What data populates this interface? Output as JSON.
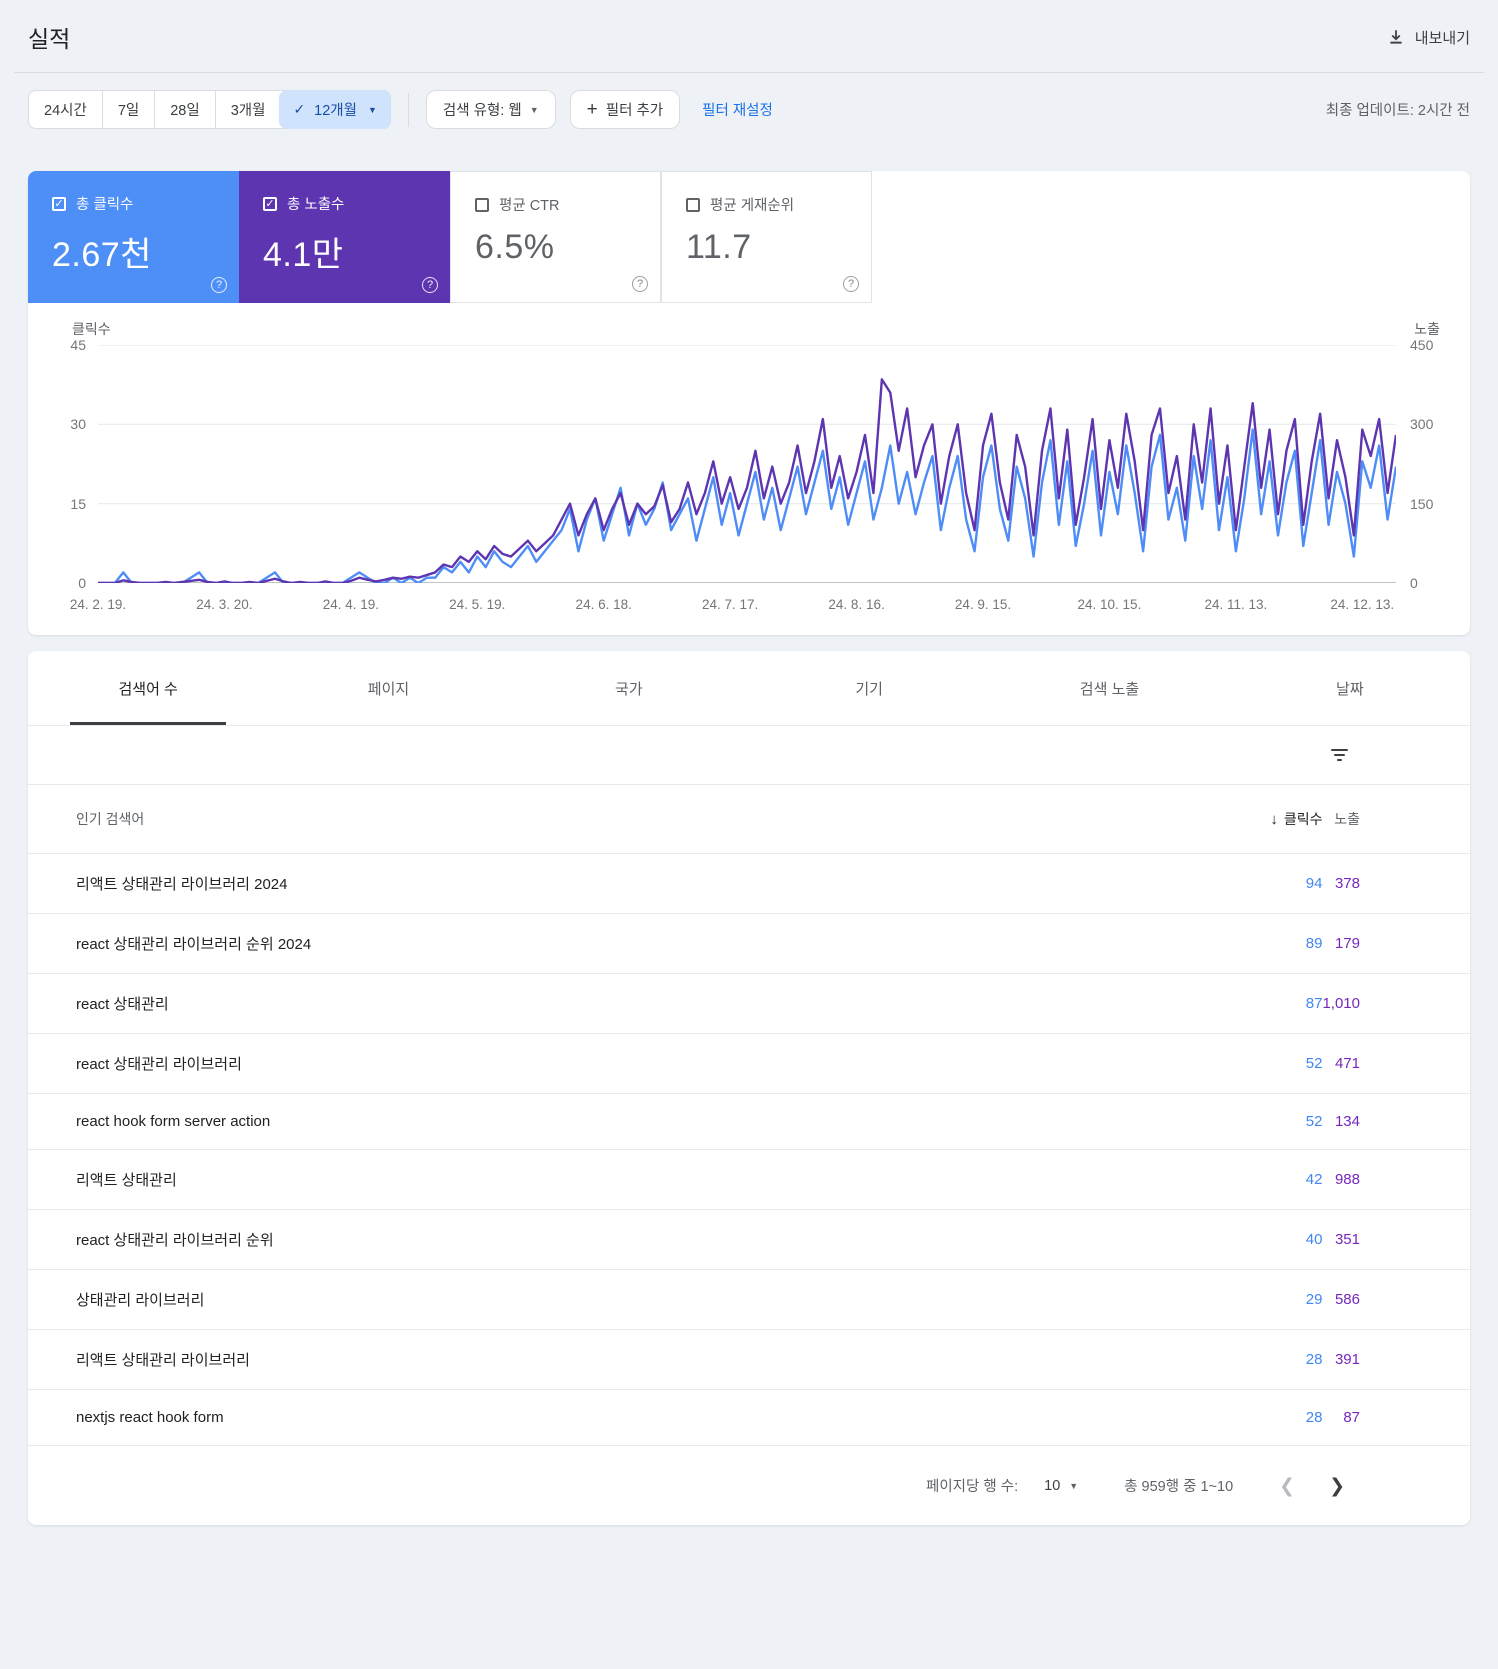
{
  "header": {
    "title": "실적",
    "export_label": "내보내기"
  },
  "toolbar": {
    "date_ranges": [
      "24시간",
      "7일",
      "28일",
      "3개월"
    ],
    "selected_range": "12개월",
    "search_type_label": "검색 유형: 웹",
    "add_filter_label": "필터 추가",
    "reset_filters_label": "필터 재설정",
    "last_updated": "최종 업데이트: 2시간 전"
  },
  "metrics": [
    {
      "label": "총 클릭수",
      "value": "2.67천",
      "checked": true,
      "color": "#4d8ef7"
    },
    {
      "label": "총 노출수",
      "value": "4.1만",
      "checked": true,
      "color": "#5e35b1"
    },
    {
      "label": "평균 CTR",
      "value": "6.5%",
      "checked": false,
      "color": "#ffffff"
    },
    {
      "label": "평균 게재순위",
      "value": "11.7",
      "checked": false,
      "color": "#ffffff"
    }
  ],
  "chart_data": {
    "type": "line",
    "title": "",
    "grid": "horizontal",
    "legend_position": "none",
    "left_axis": {
      "label": "클릭수",
      "ticks": [
        45,
        30,
        15,
        0
      ],
      "max": 45
    },
    "right_axis": {
      "label": "노출",
      "ticks": [
        450,
        300,
        150,
        0
      ],
      "max": 450
    },
    "x_tick_labels": [
      "24. 2. 19.",
      "24. 3. 20.",
      "24. 4. 19.",
      "24. 5. 19.",
      "24. 6. 18.",
      "24. 7. 17.",
      "24. 8. 16.",
      "24. 9. 15.",
      "24. 10. 15.",
      "24. 11. 13.",
      "24. 12. 13."
    ],
    "x_tick_indices": [
      0,
      15,
      30,
      45,
      60,
      75,
      90,
      105,
      120,
      135,
      150
    ],
    "series": [
      {
        "name": "총 클릭수",
        "axis": "left",
        "color": "#4e8df7",
        "values": [
          0,
          0,
          0,
          2,
          0,
          0,
          0,
          0,
          0,
          0,
          0,
          1,
          2,
          0,
          0,
          0,
          0,
          0,
          0,
          0,
          1,
          2,
          0,
          0,
          0,
          0,
          0,
          0,
          0,
          0,
          1,
          2,
          1,
          0,
          0,
          1,
          0,
          1,
          0,
          1,
          1,
          3,
          2,
          4,
          2,
          5,
          3,
          6,
          4,
          3,
          5,
          7,
          4,
          6,
          8,
          10,
          14,
          6,
          12,
          16,
          8,
          13,
          18,
          9,
          15,
          11,
          14,
          19,
          10,
          13,
          16,
          8,
          14,
          20,
          11,
          17,
          9,
          15,
          21,
          12,
          18,
          10,
          16,
          22,
          13,
          19,
          25,
          14,
          20,
          11,
          17,
          23,
          12,
          18,
          26,
          15,
          21,
          13,
          19,
          24,
          10,
          18,
          24,
          12,
          6,
          20,
          26,
          14,
          8,
          22,
          16,
          5,
          19,
          27,
          11,
          23,
          7,
          15,
          25,
          9,
          21,
          13,
          26,
          17,
          6,
          22,
          28,
          12,
          18,
          8,
          24,
          14,
          27,
          10,
          20,
          6,
          16,
          29,
          13,
          23,
          9,
          19,
          25,
          7,
          17,
          27,
          11,
          21,
          15,
          5,
          23,
          18,
          26,
          12,
          22
        ]
      },
      {
        "name": "총 노출수",
        "axis": "right",
        "color": "#5e35b1",
        "values": [
          0,
          0,
          0,
          5,
          2,
          0,
          0,
          0,
          2,
          0,
          2,
          4,
          6,
          2,
          0,
          3,
          0,
          0,
          2,
          0,
          4,
          8,
          3,
          0,
          2,
          0,
          0,
          3,
          0,
          0,
          4,
          10,
          6,
          3,
          6,
          10,
          8,
          12,
          10,
          15,
          20,
          35,
          30,
          50,
          40,
          60,
          45,
          70,
          55,
          50,
          65,
          80,
          60,
          75,
          90,
          120,
          150,
          90,
          130,
          160,
          100,
          140,
          170,
          110,
          150,
          130,
          145,
          185,
          115,
          140,
          190,
          130,
          170,
          230,
          150,
          200,
          140,
          180,
          250,
          160,
          220,
          150,
          190,
          260,
          170,
          230,
          310,
          180,
          240,
          160,
          210,
          280,
          170,
          385,
          360,
          250,
          330,
          200,
          260,
          300,
          150,
          240,
          300,
          170,
          100,
          260,
          320,
          190,
          120,
          280,
          220,
          90,
          250,
          330,
          160,
          290,
          110,
          200,
          310,
          140,
          270,
          180,
          320,
          230,
          100,
          280,
          330,
          170,
          240,
          120,
          300,
          190,
          330,
          150,
          260,
          100,
          220,
          340,
          180,
          290,
          130,
          250,
          310,
          110,
          230,
          320,
          160,
          270,
          200,
          90,
          290,
          240,
          310,
          170,
          280
        ]
      }
    ]
  },
  "tabs": [
    {
      "label": "검색어 수",
      "active": true
    },
    {
      "label": "페이지",
      "active": false
    },
    {
      "label": "국가",
      "active": false
    },
    {
      "label": "기기",
      "active": false
    },
    {
      "label": "검색 노출",
      "active": false
    },
    {
      "label": "날짜",
      "active": false
    }
  ],
  "table": {
    "columns": {
      "query": "인기 검색어",
      "clicks": "클릭수",
      "impressions": "노출"
    },
    "sort_column": "클릭수",
    "rows": [
      {
        "query": "리액트 상태관리 라이브러리 2024",
        "clicks": "94",
        "impressions": "378"
      },
      {
        "query": "react 상태관리 라이브러리 순위 2024",
        "clicks": "89",
        "impressions": "179"
      },
      {
        "query": "react 상태관리",
        "clicks": "87",
        "impressions": "1,010"
      },
      {
        "query": "react 상태관리 라이브러리",
        "clicks": "52",
        "impressions": "471"
      },
      {
        "query": "react hook form server action",
        "clicks": "52",
        "impressions": "134"
      },
      {
        "query": "리액트 상태관리",
        "clicks": "42",
        "impressions": "988"
      },
      {
        "query": "react 상태관리 라이브러리 순위",
        "clicks": "40",
        "impressions": "351"
      },
      {
        "query": "상태관리 라이브러리",
        "clicks": "29",
        "impressions": "586"
      },
      {
        "query": "리액트 상태관리 라이브러리",
        "clicks": "28",
        "impressions": "391"
      },
      {
        "query": "nextjs react hook form",
        "clicks": "28",
        "impressions": "87"
      }
    ]
  },
  "pagination": {
    "rows_per_page_label": "페이지당 행 수:",
    "rows_per_page": "10",
    "range_label": "총 959행 중 1~10"
  }
}
